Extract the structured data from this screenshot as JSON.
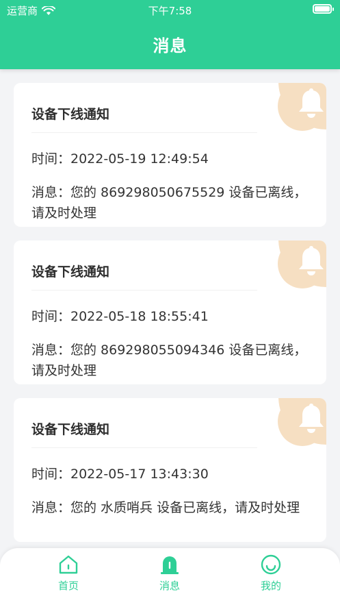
{
  "status_bar": {
    "carrier": "运营商",
    "time": "下午7:58"
  },
  "header": {
    "title": "消息"
  },
  "messages": [
    {
      "title": "设备下线通知",
      "time": "时间：2022-05-19 12:49:54",
      "text": "消息：您的 869298050675529 设备已离线，请及时处理"
    },
    {
      "title": "设备下线通知",
      "time": "时间：2022-05-18 18:55:41",
      "text": "消息：您的 869298055094346 设备已离线，请及时处理"
    },
    {
      "title": "设备下线通知",
      "time": "时间：2022-05-17 13:43:30",
      "text": "消息：您的 水质哨兵 设备已离线，请及时处理"
    }
  ],
  "tabbar": {
    "home": "首页",
    "messages": "消息",
    "mine": "我的"
  },
  "colors": {
    "primary": "#2ecf96",
    "bell_bg": "#f6dfc2"
  },
  "icons": {
    "bell": "bell-icon",
    "home": "home-icon",
    "messages": "alarm-icon",
    "mine": "smile-icon"
  }
}
